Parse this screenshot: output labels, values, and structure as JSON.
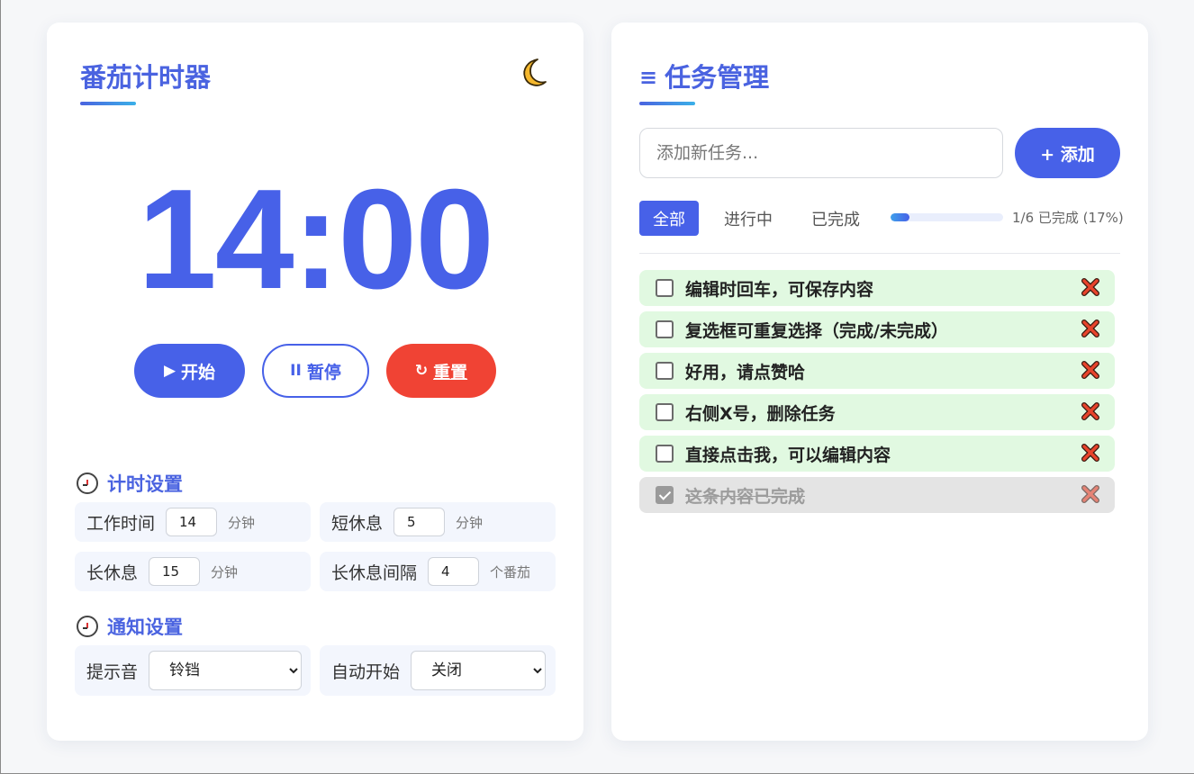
{
  "timer": {
    "title": "番茄计时器",
    "display": "14:00",
    "theme_toggle_icon": "moon-icon",
    "buttons": {
      "start": {
        "icon": "▶",
        "label": "开始"
      },
      "pause": {
        "icon": "II",
        "label": "暂停"
      },
      "reset": {
        "icon": "↻",
        "label": "重置"
      }
    }
  },
  "timing_settings": {
    "title": "计时设置",
    "work": {
      "label": "工作时间",
      "value": "14",
      "unit": "分钟"
    },
    "short_break": {
      "label": "短休息",
      "value": "5",
      "unit": "分钟"
    },
    "long_break": {
      "label": "长休息",
      "value": "15",
      "unit": "分钟"
    },
    "long_interval": {
      "label": "长休息间隔",
      "value": "4",
      "unit": "个番茄"
    }
  },
  "notify_settings": {
    "title": "通知设置",
    "sound": {
      "label": "提示音",
      "selected": "铃铛"
    },
    "auto_start": {
      "label": "自动开始",
      "selected": "关闭"
    }
  },
  "tasks": {
    "title": "任务管理",
    "input_placeholder": "添加新任务...",
    "add_label": "+ 添加",
    "filters": [
      "全部",
      "进行中",
      "已完成"
    ],
    "active_filter": "全部",
    "progress_text": "1/6 已完成 (17%)",
    "progress_fraction": 0.17,
    "items": [
      {
        "text": "编辑时回车，可保存内容",
        "done": false
      },
      {
        "text": "复选框可重复选择（完成/未完成）",
        "done": false
      },
      {
        "text": "好用，请点赞哈",
        "done": false
      },
      {
        "text": "右侧X号，删除任务",
        "done": false
      },
      {
        "text": "直接点击我，可以编辑内容",
        "done": false
      },
      {
        "text": "这条内容已完成",
        "done": true
      }
    ]
  },
  "colors": {
    "accent": "#4761e8",
    "danger": "#f04334",
    "task_bg": "#e1f9e1",
    "done_bg": "#e4e4e4"
  }
}
